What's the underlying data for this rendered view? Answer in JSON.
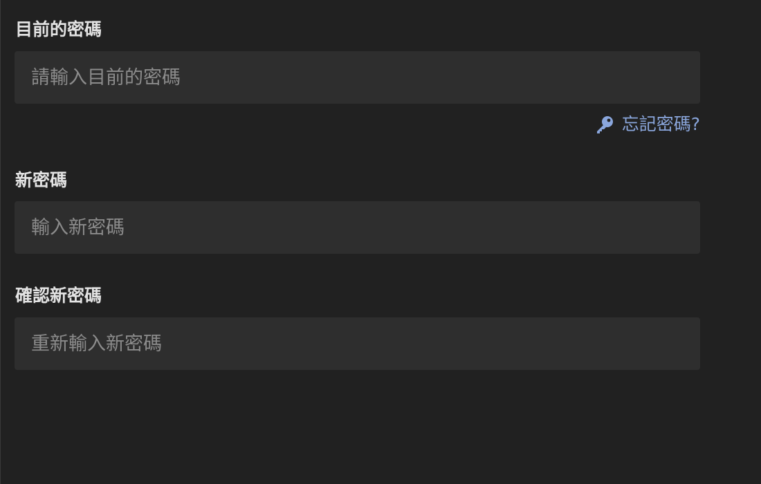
{
  "current_password": {
    "label": "目前的密碼",
    "placeholder": "請輸入目前的密碼"
  },
  "forgot_password": {
    "icon": "key-icon",
    "label": "忘記密碼?",
    "color": "#8aa6dc"
  },
  "new_password": {
    "label": "新密碼",
    "placeholder": "輸入新密碼"
  },
  "confirm_password": {
    "label": "確認新密碼",
    "placeholder": "重新輸入新密碼"
  },
  "colors": {
    "background": "#212121",
    "input_background": "#2e2e2e",
    "label_text": "#e3e3e3",
    "placeholder_text": "#8c8c8c"
  }
}
